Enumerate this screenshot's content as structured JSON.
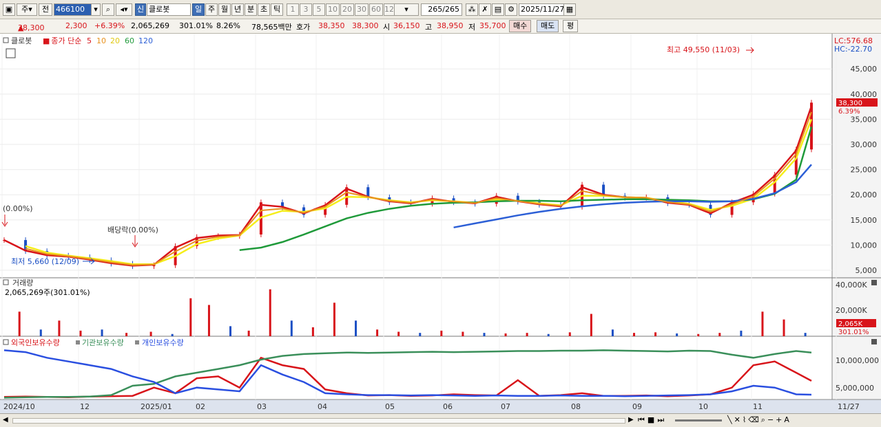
{
  "toolbar": {
    "market_label": "주",
    "prev_label": "전",
    "code_value": "466100",
    "new_label": "신",
    "name_value": "클로봇",
    "period_tabs": [
      "일",
      "주",
      "월",
      "년",
      "분",
      "초",
      "틱"
    ],
    "interval_tabs": [
      "1",
      "3",
      "5",
      "10",
      "20",
      "30",
      "60",
      "120"
    ],
    "count_value": "265",
    "count_total": "/265",
    "date_value": "2025/11/27"
  },
  "quote": {
    "price": "38,300",
    "arrow": "▲",
    "change": "2,300",
    "change_pct": "+6.39%",
    "volume": "2,065,269",
    "vol_ratio": "301.01%",
    "turnover": "8.26%",
    "amount": "78,565백만",
    "bid_label": "호가",
    "bid1": "38,350",
    "bid2": "38,300",
    "open_label": "시",
    "open": "36,150",
    "high_label": "고",
    "high": "38,950",
    "low_label": "저",
    "low": "35,700",
    "buy_label": "매수",
    "sell_label": "매도",
    "avg_label": "평"
  },
  "legend": {
    "name": "클로봇",
    "series_prefix": "종가 단순",
    "ma5": "5",
    "ma10": "10",
    "ma20": "20",
    "ma60": "60",
    "ma120": "120",
    "lc": "LC:576.68",
    "hc": "HC:-22.70"
  },
  "annotations": {
    "high": "최고 49,550 (11/03)",
    "low": "최저 5,660 (12/09)",
    "dividend": "배당락(0.00%)",
    "left_mark": "(0.00%)",
    "price_box": "38,300",
    "pct_box": "6.39%"
  },
  "volume_panel": {
    "title": "거래량",
    "value_label": "2,065,269주(301.01%)",
    "box_value": "2,065K",
    "box_pct": "301.01%",
    "ticks": [
      "40,000K",
      "20,000K"
    ]
  },
  "holding_panel": {
    "series": [
      "외국인보유수량",
      "기관보유수량",
      "개인보유수량"
    ],
    "ticks": [
      "10,000,000",
      "5,000,000"
    ]
  },
  "x_axis": [
    "2024/10",
    "12",
    "2025/01",
    "02",
    "03",
    "04",
    "05",
    "06",
    "07",
    "08",
    "09",
    "10",
    "11",
    "11/27"
  ],
  "colors": {
    "up": "#d8141a",
    "down": "#1b4fc4",
    "ma5": "#d8141a",
    "ma10": "#e8921e",
    "ma20": "#f5ee1a",
    "ma60": "#1f9a3a",
    "ma120": "#2c5fd6",
    "foreign": "#d8141a",
    "inst": "#3a8f5a",
    "indiv": "#2a4fe0"
  },
  "chart_data": [
    {
      "type": "line",
      "title": "클로봇 일봉",
      "ylim": [
        3500,
        52000
      ],
      "y_ticks": [
        5000,
        10000,
        15000,
        20000,
        25000,
        30000,
        35000,
        40000,
        45000
      ],
      "x": [
        0,
        7,
        14,
        21,
        28,
        35,
        42,
        49,
        56,
        63,
        70,
        77,
        84,
        91,
        98,
        105,
        112,
        119,
        126,
        133,
        140,
        147,
        154,
        161,
        168,
        175,
        182,
        189,
        196,
        203,
        210,
        217,
        224,
        231,
        238,
        245,
        252,
        259,
        264
      ],
      "series": [
        {
          "name": "종가",
          "values": [
            11000,
            8800,
            7900,
            7600,
            7000,
            6300,
            5800,
            6000,
            9800,
            11600,
            11800,
            12100,
            18500,
            17500,
            16000,
            18000,
            21500,
            19500,
            18500,
            18200,
            19300,
            18500,
            18200,
            19800,
            18600,
            18000,
            17600,
            22000,
            19800,
            19400,
            19500,
            18300,
            18000,
            16000,
            18500,
            20200,
            24000,
            29000,
            38300
          ]
        },
        {
          "name": "5",
          "values": [
            11000,
            8900,
            8000,
            7700,
            7100,
            6400,
            5900,
            6100,
            9500,
            11400,
            11900,
            12000,
            18000,
            17600,
            16300,
            17900,
            21200,
            19600,
            18700,
            18300,
            19200,
            18600,
            18300,
            19600,
            18700,
            18100,
            17700,
            21500,
            20000,
            19500,
            19400,
            18400,
            18000,
            16300,
            18400,
            20000,
            23800,
            28800,
            37600
          ]
        },
        {
          "name": "20",
          "values": [
            null,
            9800,
            8500,
            7900,
            7400,
            6800,
            6200,
            6200,
            7800,
            10200,
            11300,
            11900,
            15500,
            16800,
            16600,
            17300,
            19600,
            19500,
            18900,
            18500,
            18900,
            18700,
            18400,
            19000,
            18800,
            18300,
            17900,
            19800,
            19800,
            19500,
            19400,
            18700,
            18200,
            17000,
            17800,
            19200,
            22500,
            27200,
            35000
          ]
        },
        {
          "name": "60",
          "values": [
            null,
            null,
            null,
            null,
            null,
            null,
            null,
            null,
            null,
            null,
            null,
            9000,
            9500,
            10600,
            12100,
            13700,
            15300,
            16400,
            17200,
            17800,
            18200,
            18400,
            18500,
            18700,
            18800,
            18800,
            18700,
            18900,
            19000,
            19100,
            19100,
            19000,
            18900,
            18700,
            18700,
            19100,
            20200,
            23000,
            33500
          ]
        },
        {
          "name": "120",
          "values": [
            null,
            null,
            null,
            null,
            null,
            null,
            null,
            null,
            null,
            null,
            null,
            null,
            null,
            null,
            null,
            null,
            null,
            null,
            null,
            null,
            null,
            13500,
            14300,
            15100,
            15900,
            16600,
            17200,
            17700,
            18100,
            18400,
            18600,
            18700,
            18700,
            18600,
            18700,
            19200,
            20300,
            22500,
            26000
          ]
        }
      ]
    },
    {
      "type": "bar",
      "title": "거래량",
      "ylim": [
        0,
        48000
      ],
      "x": [
        5,
        12,
        18,
        25,
        32,
        40,
        48,
        55,
        61,
        67,
        74,
        80,
        87,
        94,
        101,
        108,
        115,
        122,
        129,
        136,
        143,
        150,
        157,
        164,
        171,
        178,
        185,
        192,
        199,
        206,
        213,
        220,
        227,
        234,
        241,
        248,
        255,
        262
      ],
      "values": [
        22000,
        6000,
        14000,
        5000,
        6000,
        3000,
        4000,
        2000,
        34000,
        28000,
        9000,
        5000,
        42000,
        14000,
        8000,
        30000,
        14000,
        6000,
        4000,
        3000,
        5000,
        4000,
        3000,
        2500,
        3000,
        2000,
        3500,
        20000,
        6000,
        3000,
        3500,
        2500,
        2000,
        3000,
        5000,
        22000,
        15000,
        3000
      ]
    },
    {
      "type": "line",
      "title": "보유수량",
      "ylim": [
        0,
        14000000
      ],
      "x": [
        0,
        7,
        14,
        21,
        28,
        35,
        42,
        49,
        56,
        63,
        70,
        77,
        84,
        91,
        98,
        105,
        112,
        119,
        126,
        133,
        140,
        147,
        154,
        161,
        168,
        175,
        182,
        189,
        196,
        203,
        210,
        217,
        224,
        231,
        238,
        245,
        252,
        259,
        264
      ],
      "series": [
        {
          "name": "외국인보유수량",
          "values": [
            500000,
            600000,
            500000,
            400000,
            600000,
            700000,
            800000,
            3000000,
            1500000,
            5500000,
            6000000,
            3000000,
            11000000,
            9000000,
            8000000,
            2500000,
            1500000,
            900000,
            1000000,
            800000,
            900000,
            1200000,
            1000000,
            900000,
            5000000,
            800000,
            1000000,
            1500000,
            800000,
            800000,
            900000,
            700000,
            900000,
            1200000,
            3000000,
            9000000,
            10000000,
            7000000,
            4800000
          ]
        },
        {
          "name": "기관보유수량",
          "values": [
            300000,
            400000,
            500000,
            500000,
            600000,
            1000000,
            3500000,
            4000000,
            6000000,
            7000000,
            8000000,
            9000000,
            10500000,
            11500000,
            12000000,
            12200000,
            12400000,
            12300000,
            12400000,
            12500000,
            12600000,
            12500000,
            12600000,
            12700000,
            12800000,
            12800000,
            12900000,
            12900000,
            13000000,
            12900000,
            12800000,
            12700000,
            12900000,
            12800000,
            11800000,
            11000000,
            12000000,
            12800000,
            12400000
          ]
        },
        {
          "name": "개인보유수량",
          "values": [
            13000000,
            12500000,
            11000000,
            10000000,
            9000000,
            8000000,
            6000000,
            4500000,
            1500000,
            3000000,
            2500000,
            2000000,
            9000000,
            6500000,
            4500000,
            1500000,
            1200000,
            1000000,
            1000000,
            900000,
            1000000,
            900000,
            800000,
            900000,
            800000,
            800000,
            900000,
            800000,
            800000,
            700000,
            800000,
            900000,
            1000000,
            1200000,
            2000000,
            3500000,
            3000000,
            1200000,
            1100000
          ]
        }
      ]
    }
  ]
}
